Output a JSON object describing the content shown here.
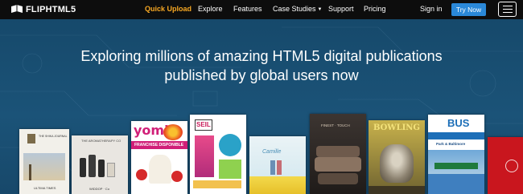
{
  "brand": {
    "name": "FLIPHTML5",
    "logo_icon": "fliphtml5-logo-icon"
  },
  "nav": {
    "quick_upload": "Quick Upload",
    "explore": "Explore",
    "features": "Features",
    "case_studies": "Case Studies",
    "support": "Support",
    "pricing": "Pricing",
    "sign_in": "Sign in",
    "try_now": "Try Now"
  },
  "hero": {
    "line1": "Exploring millions of amazing HTML5 digital publications",
    "line2": "published by global users now"
  },
  "books": {
    "b1": {
      "title": "THE SHIKA JOURNAL",
      "footer": "ULTIMA TIMES"
    },
    "b2": {
      "title": "THE AROMATHERAPY CO",
      "footer": "WIDDOP · Co"
    },
    "b3": {
      "title": "yomi",
      "band": "FRANCHISE DISPONIBLE"
    },
    "b4": {
      "title": "SEIL"
    },
    "b5": {
      "title": "Camille"
    },
    "b6": {
      "title": "FINEST · TOUCH"
    },
    "b7": {
      "title": "BOWLING"
    },
    "b8": {
      "title": "BUS",
      "sub": "Park & Baltimore"
    }
  },
  "colors": {
    "accent": "#f7a823",
    "button": "#2a88d8",
    "nav_bg": "#0d0d0d",
    "hero_bg": "#16496b"
  }
}
